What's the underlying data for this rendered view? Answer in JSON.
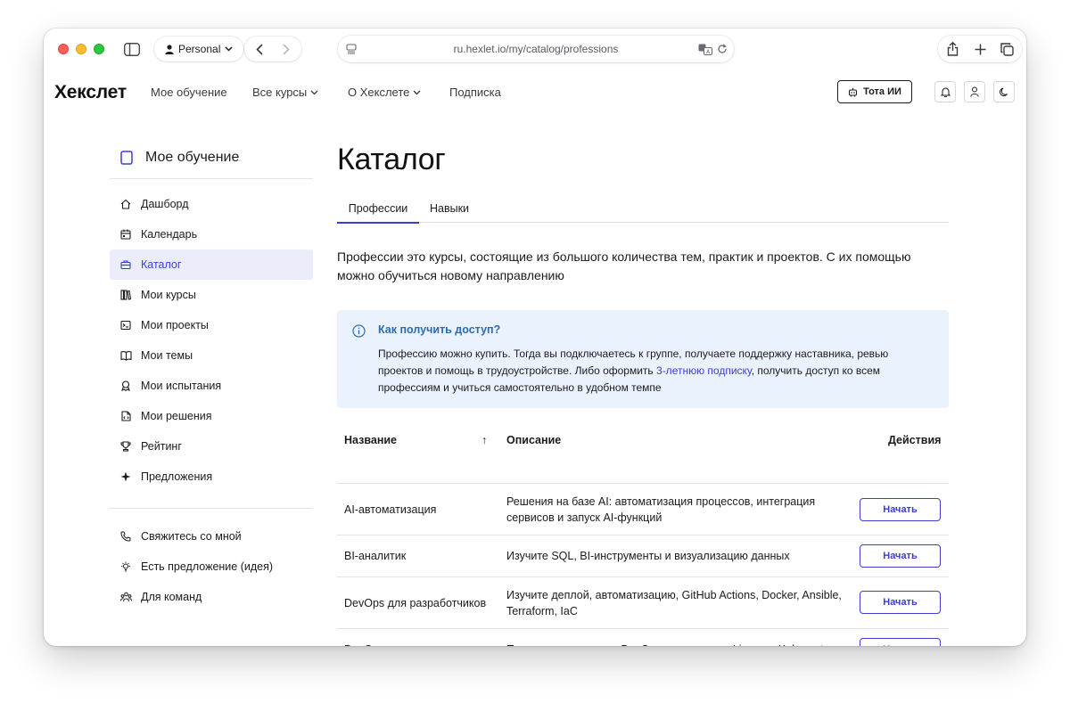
{
  "browser": {
    "profile_label": "Personal",
    "url": "ru.hexlet.io/my/catalog/professions"
  },
  "header": {
    "logo": "Хекслет",
    "nav": [
      {
        "label": "Мое обучение",
        "has_dropdown": false
      },
      {
        "label": "Все курсы",
        "has_dropdown": true
      },
      {
        "label": "О Хекслете",
        "has_dropdown": true
      },
      {
        "label": "Подписка",
        "has_dropdown": false
      }
    ],
    "ai_button_label": "Тота ИИ"
  },
  "sidebar": {
    "title": "Мое обучение",
    "items": [
      {
        "label": "Дашборд",
        "icon": "home-icon",
        "active": false
      },
      {
        "label": "Календарь",
        "icon": "calendar-icon",
        "active": false
      },
      {
        "label": "Каталог",
        "icon": "briefcase-icon",
        "active": true
      },
      {
        "label": "Мои курсы",
        "icon": "books-icon",
        "active": false
      },
      {
        "label": "Мои проекты",
        "icon": "terminal-icon",
        "active": false
      },
      {
        "label": "Мои темы",
        "icon": "book-open-icon",
        "active": false
      },
      {
        "label": "Мои испытания",
        "icon": "award-icon",
        "active": false
      },
      {
        "label": "Мои решения",
        "icon": "file-code-icon",
        "active": false
      },
      {
        "label": "Рейтинг",
        "icon": "trophy-icon",
        "active": false
      },
      {
        "label": "Предложения",
        "icon": "sparkle-icon",
        "active": false
      }
    ],
    "secondary_items": [
      {
        "label": "Свяжитесь со мной",
        "icon": "phone-icon"
      },
      {
        "label": "Есть предложение (идея)",
        "icon": "bulb-icon"
      },
      {
        "label": "Для команд",
        "icon": "team-icon"
      }
    ]
  },
  "main": {
    "title": "Каталог",
    "tabs": [
      {
        "label": "Профессии",
        "active": true
      },
      {
        "label": "Навыки",
        "active": false
      }
    ],
    "intro": "Профессии это курсы, состоящие из большого количества тем, практик и проектов. С их помощью можно обучиться новому направлению",
    "info": {
      "title": "Как получить доступ?",
      "text_before": "Профессию можно купить. Тогда вы подключаетесь к группе, получаете поддержку наставника, ревью проектов и помощь в трудоустройстве. Либо оформить ",
      "link": "3-летнюю подписку",
      "text_after": ", получить доступ ко всем профессиям и учиться самостоятельно в удобном темпе"
    },
    "table": {
      "columns": {
        "name": "Название",
        "sort_indicator": "↑",
        "description": "Описание",
        "actions": "Действия"
      },
      "rows": [
        {
          "name": "AI-автоматизация",
          "description": "Решения на базе AI: автоматизация процессов, интеграция сервисов и запуск AI-функций",
          "action": "Начать"
        },
        {
          "name": "BI-аналитик",
          "description": "Изучите SQL, BI-инструменты и визуализацию данных",
          "action": "Начать"
        },
        {
          "name": "DevOps для разработчиков",
          "description": "Изучите деплой, автоматизацию, GitHub Actions, Docker, Ansible, Terraform, IaC",
          "action": "Начать"
        },
        {
          "name": "DevOps-инженер с нуля",
          "description": "Полное погружение в DevOps: весь стек от Linux до Kubernetes",
          "action": "Начать"
        }
      ]
    }
  },
  "colors": {
    "accent": "#3b3fcf",
    "active_bg": "#ecedfb",
    "info_bg": "#eaf2fd",
    "info_title": "#2b6cb0"
  }
}
